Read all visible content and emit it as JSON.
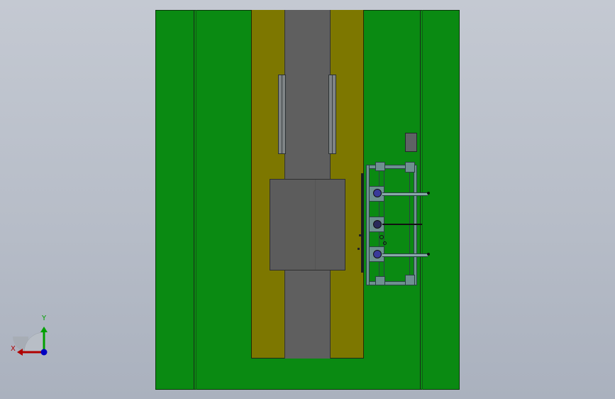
{
  "colors": {
    "background_top": "#c4c9d2",
    "background_bottom": "#aab1be",
    "plate_green": "#0a8a12",
    "side_strip_olive": "#7d7700",
    "belt_grey": "#5f5f5f",
    "carriage_grey": "#5c5c5c",
    "bracket_teal": "#6e9090",
    "axis_x": "#b00000",
    "axis_y": "#00a000",
    "axis_z": "#0000c0"
  },
  "triad": {
    "x_label": "X",
    "y_label": "Y",
    "icon": "view-orientation-triad-icon"
  }
}
